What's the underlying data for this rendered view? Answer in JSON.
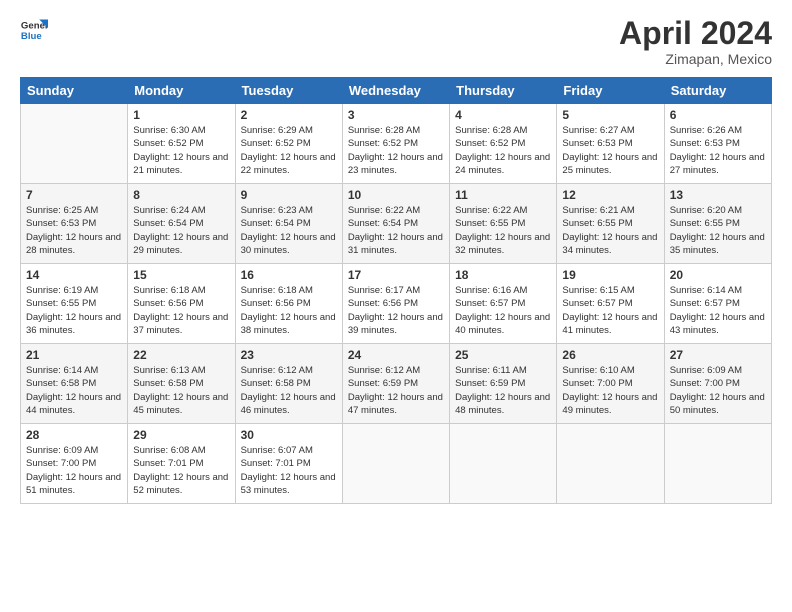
{
  "logo": {
    "line1": "General",
    "line2": "Blue"
  },
  "title": "April 2024",
  "location": "Zimapan, Mexico",
  "days_header": [
    "Sunday",
    "Monday",
    "Tuesday",
    "Wednesday",
    "Thursday",
    "Friday",
    "Saturday"
  ],
  "weeks": [
    [
      {
        "day": "",
        "sunrise": "",
        "sunset": "",
        "daylight": ""
      },
      {
        "day": "1",
        "sunrise": "Sunrise: 6:30 AM",
        "sunset": "Sunset: 6:52 PM",
        "daylight": "Daylight: 12 hours and 21 minutes."
      },
      {
        "day": "2",
        "sunrise": "Sunrise: 6:29 AM",
        "sunset": "Sunset: 6:52 PM",
        "daylight": "Daylight: 12 hours and 22 minutes."
      },
      {
        "day": "3",
        "sunrise": "Sunrise: 6:28 AM",
        "sunset": "Sunset: 6:52 PM",
        "daylight": "Daylight: 12 hours and 23 minutes."
      },
      {
        "day": "4",
        "sunrise": "Sunrise: 6:28 AM",
        "sunset": "Sunset: 6:52 PM",
        "daylight": "Daylight: 12 hours and 24 minutes."
      },
      {
        "day": "5",
        "sunrise": "Sunrise: 6:27 AM",
        "sunset": "Sunset: 6:53 PM",
        "daylight": "Daylight: 12 hours and 25 minutes."
      },
      {
        "day": "6",
        "sunrise": "Sunrise: 6:26 AM",
        "sunset": "Sunset: 6:53 PM",
        "daylight": "Daylight: 12 hours and 27 minutes."
      }
    ],
    [
      {
        "day": "7",
        "sunrise": "Sunrise: 6:25 AM",
        "sunset": "Sunset: 6:53 PM",
        "daylight": "Daylight: 12 hours and 28 minutes."
      },
      {
        "day": "8",
        "sunrise": "Sunrise: 6:24 AM",
        "sunset": "Sunset: 6:54 PM",
        "daylight": "Daylight: 12 hours and 29 minutes."
      },
      {
        "day": "9",
        "sunrise": "Sunrise: 6:23 AM",
        "sunset": "Sunset: 6:54 PM",
        "daylight": "Daylight: 12 hours and 30 minutes."
      },
      {
        "day": "10",
        "sunrise": "Sunrise: 6:22 AM",
        "sunset": "Sunset: 6:54 PM",
        "daylight": "Daylight: 12 hours and 31 minutes."
      },
      {
        "day": "11",
        "sunrise": "Sunrise: 6:22 AM",
        "sunset": "Sunset: 6:55 PM",
        "daylight": "Daylight: 12 hours and 32 minutes."
      },
      {
        "day": "12",
        "sunrise": "Sunrise: 6:21 AM",
        "sunset": "Sunset: 6:55 PM",
        "daylight": "Daylight: 12 hours and 34 minutes."
      },
      {
        "day": "13",
        "sunrise": "Sunrise: 6:20 AM",
        "sunset": "Sunset: 6:55 PM",
        "daylight": "Daylight: 12 hours and 35 minutes."
      }
    ],
    [
      {
        "day": "14",
        "sunrise": "Sunrise: 6:19 AM",
        "sunset": "Sunset: 6:55 PM",
        "daylight": "Daylight: 12 hours and 36 minutes."
      },
      {
        "day": "15",
        "sunrise": "Sunrise: 6:18 AM",
        "sunset": "Sunset: 6:56 PM",
        "daylight": "Daylight: 12 hours and 37 minutes."
      },
      {
        "day": "16",
        "sunrise": "Sunrise: 6:18 AM",
        "sunset": "Sunset: 6:56 PM",
        "daylight": "Daylight: 12 hours and 38 minutes."
      },
      {
        "day": "17",
        "sunrise": "Sunrise: 6:17 AM",
        "sunset": "Sunset: 6:56 PM",
        "daylight": "Daylight: 12 hours and 39 minutes."
      },
      {
        "day": "18",
        "sunrise": "Sunrise: 6:16 AM",
        "sunset": "Sunset: 6:57 PM",
        "daylight": "Daylight: 12 hours and 40 minutes."
      },
      {
        "day": "19",
        "sunrise": "Sunrise: 6:15 AM",
        "sunset": "Sunset: 6:57 PM",
        "daylight": "Daylight: 12 hours and 41 minutes."
      },
      {
        "day": "20",
        "sunrise": "Sunrise: 6:14 AM",
        "sunset": "Sunset: 6:57 PM",
        "daylight": "Daylight: 12 hours and 43 minutes."
      }
    ],
    [
      {
        "day": "21",
        "sunrise": "Sunrise: 6:14 AM",
        "sunset": "Sunset: 6:58 PM",
        "daylight": "Daylight: 12 hours and 44 minutes."
      },
      {
        "day": "22",
        "sunrise": "Sunrise: 6:13 AM",
        "sunset": "Sunset: 6:58 PM",
        "daylight": "Daylight: 12 hours and 45 minutes."
      },
      {
        "day": "23",
        "sunrise": "Sunrise: 6:12 AM",
        "sunset": "Sunset: 6:58 PM",
        "daylight": "Daylight: 12 hours and 46 minutes."
      },
      {
        "day": "24",
        "sunrise": "Sunrise: 6:12 AM",
        "sunset": "Sunset: 6:59 PM",
        "daylight": "Daylight: 12 hours and 47 minutes."
      },
      {
        "day": "25",
        "sunrise": "Sunrise: 6:11 AM",
        "sunset": "Sunset: 6:59 PM",
        "daylight": "Daylight: 12 hours and 48 minutes."
      },
      {
        "day": "26",
        "sunrise": "Sunrise: 6:10 AM",
        "sunset": "Sunset: 7:00 PM",
        "daylight": "Daylight: 12 hours and 49 minutes."
      },
      {
        "day": "27",
        "sunrise": "Sunrise: 6:09 AM",
        "sunset": "Sunset: 7:00 PM",
        "daylight": "Daylight: 12 hours and 50 minutes."
      }
    ],
    [
      {
        "day": "28",
        "sunrise": "Sunrise: 6:09 AM",
        "sunset": "Sunset: 7:00 PM",
        "daylight": "Daylight: 12 hours and 51 minutes."
      },
      {
        "day": "29",
        "sunrise": "Sunrise: 6:08 AM",
        "sunset": "Sunset: 7:01 PM",
        "daylight": "Daylight: 12 hours and 52 minutes."
      },
      {
        "day": "30",
        "sunrise": "Sunrise: 6:07 AM",
        "sunset": "Sunset: 7:01 PM",
        "daylight": "Daylight: 12 hours and 53 minutes."
      },
      {
        "day": "",
        "sunrise": "",
        "sunset": "",
        "daylight": ""
      },
      {
        "day": "",
        "sunrise": "",
        "sunset": "",
        "daylight": ""
      },
      {
        "day": "",
        "sunrise": "",
        "sunset": "",
        "daylight": ""
      },
      {
        "day": "",
        "sunrise": "",
        "sunset": "",
        "daylight": ""
      }
    ]
  ]
}
